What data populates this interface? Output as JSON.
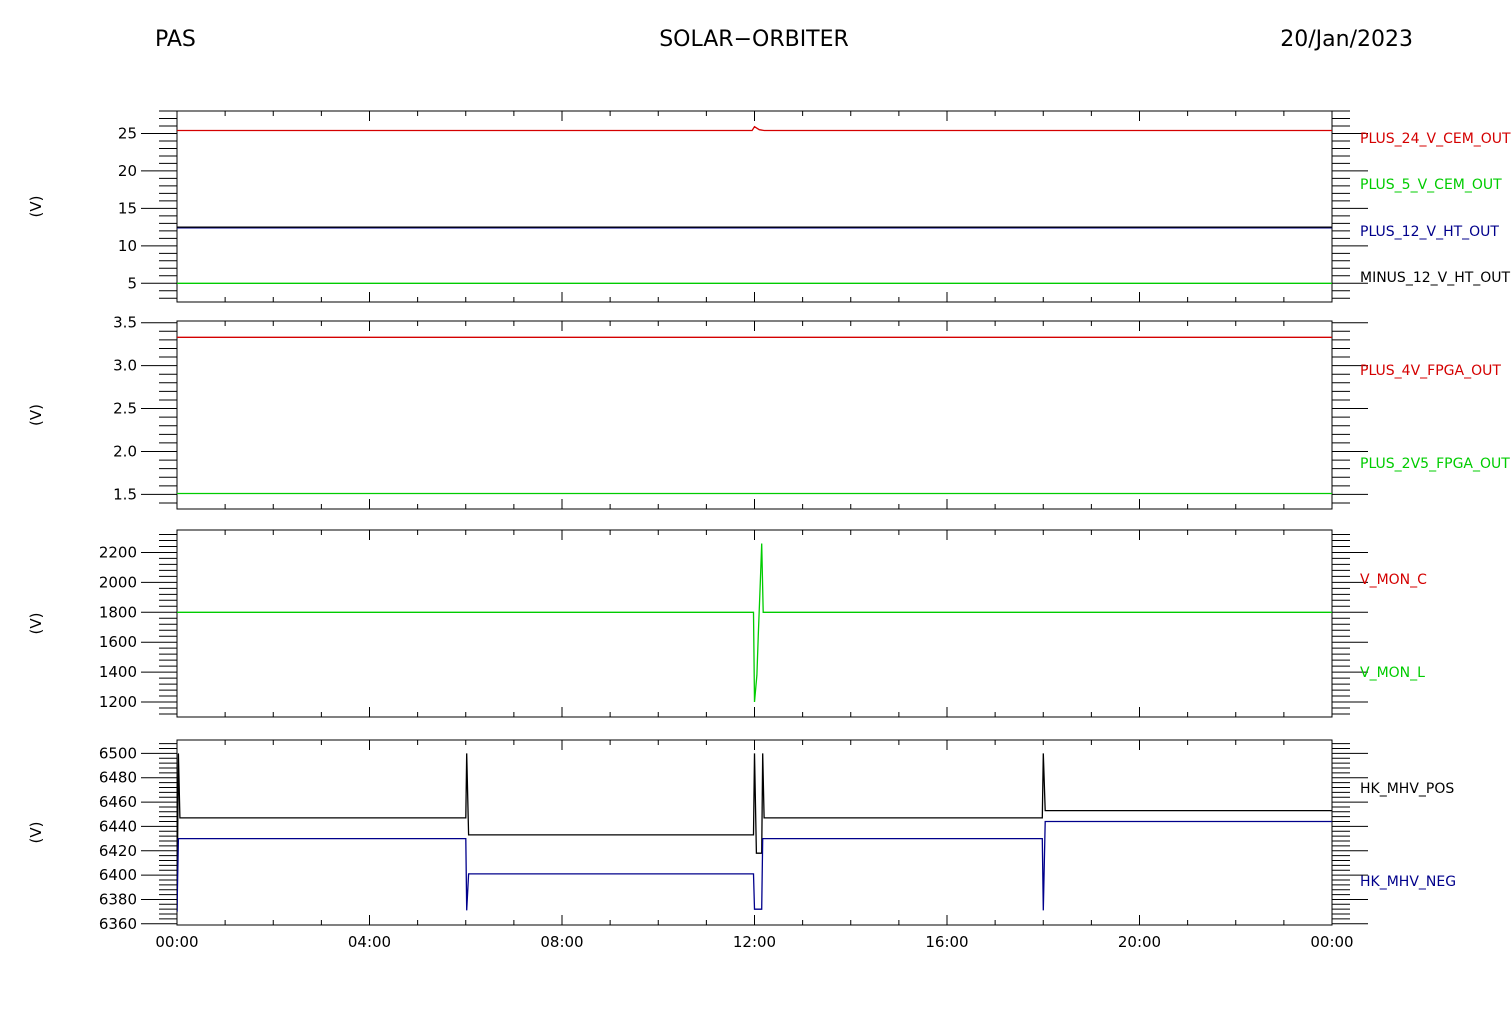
{
  "header": {
    "instrument": "PAS",
    "mission": "SOLAR−ORBITER",
    "date": "20/Jan/2023"
  },
  "x_axis": {
    "tick_labels": [
      "00:00",
      "04:00",
      "08:00",
      "12:00",
      "16:00",
      "20:00",
      "00:00"
    ],
    "range_hours": [
      0,
      24
    ]
  },
  "colors": {
    "red": "#d40000",
    "green": "#00cc00",
    "blue": "#00008b",
    "black": "#000000"
  },
  "chart_data": [
    {
      "type": "line",
      "ylabel": "(V)",
      "ylim": [
        2.5,
        28
      ],
      "yticks": [
        5,
        10,
        15,
        20,
        25
      ],
      "ytick_labels": [
        "5",
        "10",
        "15",
        "20",
        "25"
      ],
      "series": [
        {
          "name": "PLUS_24_V_CEM_OUT",
          "color": "red",
          "points": [
            [
              0,
              25.4
            ],
            [
              11.95,
              25.4
            ],
            [
              12.0,
              25.9
            ],
            [
              12.1,
              25.5
            ],
            [
              12.2,
              25.4
            ],
            [
              24,
              25.4
            ]
          ]
        },
        {
          "name": "PLUS_5_V_CEM_OUT",
          "color": "green",
          "points": [
            [
              0,
              5.0
            ],
            [
              24,
              5.0
            ]
          ]
        },
        {
          "name": "PLUS_12_V_HT_OUT",
          "color": "blue",
          "points": [
            [
              0,
              12.4
            ],
            [
              24,
              12.4
            ]
          ]
        },
        {
          "name": "MINUS_12_V_HT_OUT",
          "color": "black",
          "points": [
            [
              0,
              12.5
            ],
            [
              24,
              12.5
            ]
          ]
        }
      ]
    },
    {
      "type": "line",
      "ylabel": "(V)",
      "ylim": [
        1.33,
        3.52
      ],
      "yticks": [
        1.5,
        2.0,
        2.5,
        3.0,
        3.5
      ],
      "ytick_labels": [
        "1.5",
        "2.0",
        "2.5",
        "3.0",
        "3.5"
      ],
      "series": [
        {
          "name": "PLUS_4V_FPGA_OUT",
          "color": "red",
          "points": [
            [
              0,
              3.33
            ],
            [
              24,
              3.33
            ]
          ]
        },
        {
          "name": "PLUS_2V5_FPGA_OUT",
          "color": "green",
          "points": [
            [
              0,
              1.51
            ],
            [
              24,
              1.51
            ]
          ]
        }
      ]
    },
    {
      "type": "line",
      "ylabel": "(V)",
      "ylim": [
        1100,
        2350
      ],
      "yticks": [
        1200,
        1400,
        1600,
        1800,
        2000,
        2200
      ],
      "ytick_labels": [
        "1200",
        "1400",
        "1600",
        "1800",
        "2000",
        "2200"
      ],
      "series": [
        {
          "name": "V_MON_C",
          "color": "red",
          "points": []
        },
        {
          "name": "V_MON_L",
          "color": "green",
          "points": [
            [
              0,
              1800
            ],
            [
              11.98,
              1800
            ],
            [
              12.0,
              1200
            ],
            [
              12.05,
              1380
            ],
            [
              12.08,
              1650
            ],
            [
              12.12,
              2000
            ],
            [
              12.15,
              2260
            ],
            [
              12.18,
              1800
            ],
            [
              24,
              1800
            ]
          ]
        }
      ]
    },
    {
      "type": "line",
      "ylabel": "(V)",
      "ylim": [
        6359,
        6511
      ],
      "yticks": [
        6360,
        6380,
        6400,
        6420,
        6440,
        6460,
        6480,
        6500
      ],
      "ytick_labels": [
        "6360",
        "6380",
        "6400",
        "6420",
        "6440",
        "6460",
        "6480",
        "6500"
      ],
      "series": [
        {
          "name": "HK_MHV_POS",
          "color": "black",
          "points": [
            [
              0,
              6370
            ],
            [
              0.03,
              6500
            ],
            [
              0.06,
              6447
            ],
            [
              6.0,
              6447
            ],
            [
              6.02,
              6500
            ],
            [
              6.06,
              6433
            ],
            [
              11.98,
              6433
            ],
            [
              12.0,
              6500
            ],
            [
              12.04,
              6418
            ],
            [
              12.15,
              6418
            ],
            [
              12.17,
              6500
            ],
            [
              12.2,
              6447
            ],
            [
              17.98,
              6447
            ],
            [
              18.0,
              6500
            ],
            [
              18.04,
              6453
            ],
            [
              24,
              6453
            ]
          ]
        },
        {
          "name": "HK_MHV_NEG",
          "color": "blue",
          "points": [
            [
              0,
              6370
            ],
            [
              0.03,
              6430
            ],
            [
              6.0,
              6430
            ],
            [
              6.02,
              6371
            ],
            [
              6.06,
              6401
            ],
            [
              11.98,
              6401
            ],
            [
              12.0,
              6372
            ],
            [
              12.15,
              6372
            ],
            [
              12.17,
              6430
            ],
            [
              17.98,
              6430
            ],
            [
              18.0,
              6371
            ],
            [
              18.04,
              6444
            ],
            [
              24,
              6444
            ]
          ]
        }
      ]
    }
  ]
}
